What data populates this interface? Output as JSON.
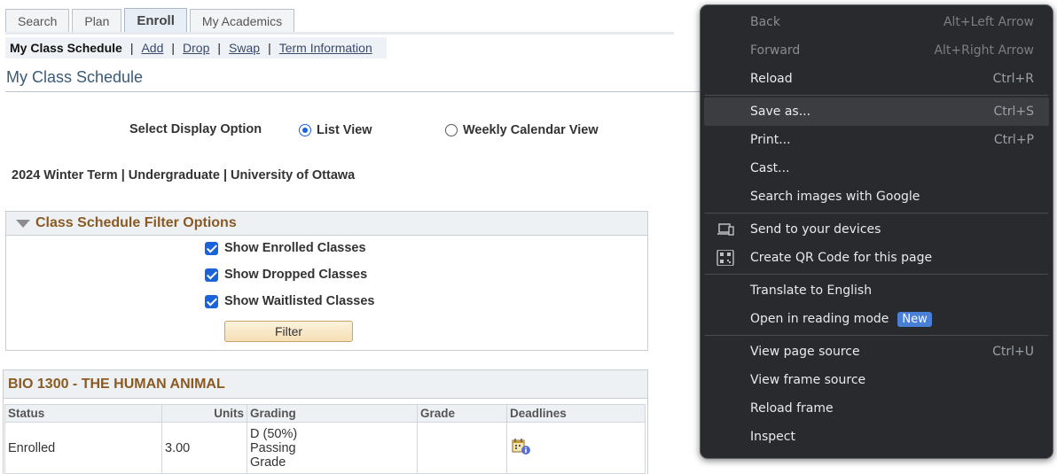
{
  "tabs": [
    {
      "label": "Search",
      "active": false
    },
    {
      "label": "Plan",
      "active": false
    },
    {
      "label": "Enroll",
      "active": true
    },
    {
      "label": "My Academics",
      "active": false
    }
  ],
  "subnav": {
    "current": "My Class Schedule",
    "links": [
      "Add",
      "Drop",
      "Swap",
      "Term Information"
    ]
  },
  "page_title": "My Class Schedule",
  "display_option": {
    "label": "Select Display Option",
    "list_view": "List View",
    "calendar_view": "Weekly Calendar View",
    "selected": "List View"
  },
  "term": "2024 Winter Term | Undergraduate | University of Ottawa",
  "filter": {
    "title": "Class Schedule Filter Options",
    "options": [
      "Show Enrolled Classes",
      "Show Dropped Classes",
      "Show Waitlisted Classes"
    ],
    "checked": [
      true,
      true,
      true
    ],
    "button_label": "Filter"
  },
  "course": {
    "title": "BIO 1300 - THE HUMAN ANIMAL",
    "columns": [
      "Status",
      "Units",
      "Grading",
      "Grade",
      "Deadlines"
    ],
    "rows": [
      {
        "status": "Enrolled",
        "units": "3.00",
        "grading": [
          "D (50%)",
          "Passing",
          "Grade"
        ],
        "grade": "",
        "deadlines_icon": "calendar-info-icon"
      }
    ]
  },
  "context_menu": {
    "groups": [
      [
        {
          "label": "Back",
          "shortcut": "Alt+Left Arrow",
          "disabled": true
        },
        {
          "label": "Forward",
          "shortcut": "Alt+Right Arrow",
          "disabled": true
        },
        {
          "label": "Reload",
          "shortcut": "Ctrl+R",
          "disabled": false
        }
      ],
      [
        {
          "label": "Save as...",
          "shortcut": "Ctrl+S",
          "hovered": true
        },
        {
          "label": "Print...",
          "shortcut": "Ctrl+P"
        },
        {
          "label": "Cast...",
          "shortcut": ""
        },
        {
          "label": "Search images with Google",
          "shortcut": ""
        }
      ],
      [
        {
          "label": "Send to your devices",
          "icon": "devices-icon"
        },
        {
          "label": "Create QR Code for this page",
          "icon": "qr-code-icon"
        }
      ],
      [
        {
          "label": "Translate to English"
        },
        {
          "label": "Open in reading mode",
          "badge": "New"
        }
      ],
      [
        {
          "label": "View page source",
          "shortcut": "Ctrl+U"
        },
        {
          "label": "View frame source"
        },
        {
          "label": "Reload frame"
        },
        {
          "label": "Inspect"
        }
      ]
    ]
  },
  "colors": {
    "section_title": "#8a5a22",
    "page_title": "#3a5a78",
    "menu_bg": "#292a2d",
    "accent_blue": "#1a63d8",
    "badge_blue": "#4a7fd6"
  }
}
